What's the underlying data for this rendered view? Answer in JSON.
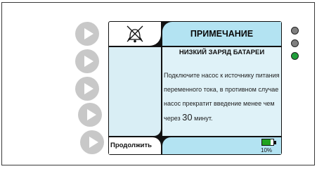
{
  "alarm_icon": "bell-alarm-icon",
  "title": "ПРИМЕЧАНИЕ",
  "subtitle": "НИЗКИЙ ЗАРЯД БАТАРЕИ",
  "message": {
    "text": "Подключите насос к источнику питания переменного тока, в противном случае насос прекратит введение менее чем через",
    "minutes": "30",
    "unit": "минут."
  },
  "continue_label": "Продолжить",
  "battery": {
    "percent_label": "10%",
    "level": 0.75,
    "icon": "battery-icon",
    "fill_color": "#1fa31f"
  },
  "soft_buttons": [
    "play-icon",
    "play-icon",
    "play-icon",
    "play-icon",
    "play-icon"
  ],
  "indicator_lights": [
    "#808080",
    "#808080",
    "#1f9e3a"
  ],
  "colors": {
    "screen_frame": "#111111",
    "title_bg": "#b3e3f2",
    "panel_bg": "#dff2f8",
    "left_panel_bg": "#d9eef5"
  }
}
